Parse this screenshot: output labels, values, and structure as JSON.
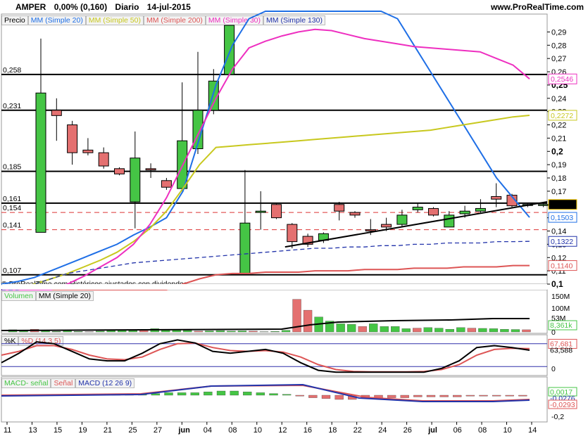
{
  "header": {
    "symbol": "AMPER",
    "change": "0,00% (0,160)",
    "period": "Diario",
    "date": "14-jul-2015",
    "site": "www.ProRealTime.com"
  },
  "price_legend": {
    "price": "Precio",
    "mm20": "MM (Simple 20)",
    "mm50": "MM (Simple 50)",
    "mm200": "MM (Simple 200)",
    "mm30": "MM (Simple 30)",
    "mm130": "MM (Simple 130)"
  },
  "copyright": "© ProRealTime.com  Históricos ajustados con dividendos",
  "volume_legend": {
    "vol": "Volumen",
    "mm": "MM (Simple 20)"
  },
  "stoch_legend": {
    "k": "%K",
    "d": "%D (14 3 5)"
  },
  "macd_legend": {
    "hist": "MACD- señal",
    "sig": "Señal",
    "macd": "MACD (12 26 9)"
  },
  "colors": {
    "up": "#45c545",
    "down": "#e47070",
    "mm20": "#1f6fe6",
    "mm50": "#c8c81e",
    "mm200": "#dd5555",
    "mm30": "#ee2fc0",
    "mm130": "#2233aa"
  },
  "chart_data": {
    "type": "candlestick",
    "x_ticks": [
      "11",
      "13",
      "15",
      "19",
      "21",
      "25",
      "27",
      "jun",
      "04",
      "08",
      "10",
      "12",
      "16",
      "18",
      "22",
      "24",
      "26",
      "jul",
      "06",
      "08",
      "10",
      "14"
    ],
    "price_axis": [
      "0,29",
      "0,28",
      "0,27",
      "0,26",
      "0,25",
      "0,24",
      "0,23",
      "0,22",
      "0,21",
      "0,2",
      "0,19",
      "0,18",
      "0,17",
      "0,16",
      "0,15",
      "0,14",
      "0,13",
      "0,12",
      "0,11",
      "0,1"
    ],
    "ylim": [
      0.1,
      0.295
    ],
    "horizontal_levels": [
      {
        "label": "0,258",
        "value": 0.258,
        "style": "solid"
      },
      {
        "label": "0,231",
        "value": 0.231,
        "style": "solid"
      },
      {
        "label": "0,185",
        "value": 0.185,
        "style": "solid"
      },
      {
        "label": "0,161",
        "value": 0.161,
        "style": "solid"
      },
      {
        "label": "0,154",
        "value": 0.154,
        "style": "dashed"
      },
      {
        "label": "0,141",
        "value": 0.141,
        "style": "dashed"
      },
      {
        "label": "0,107",
        "value": 0.107,
        "style": "solid"
      }
    ],
    "candles": [
      {
        "o": 0.139,
        "h": 0.285,
        "l": 0.139,
        "c": 0.244
      },
      {
        "o": 0.231,
        "h": 0.24,
        "l": 0.208,
        "c": 0.227
      },
      {
        "o": 0.22,
        "h": 0.223,
        "l": 0.19,
        "c": 0.199
      },
      {
        "o": 0.201,
        "h": 0.21,
        "l": 0.197,
        "c": 0.199
      },
      {
        "o": 0.199,
        "h": 0.203,
        "l": 0.187,
        "c": 0.189
      },
      {
        "o": 0.187,
        "h": 0.188,
        "l": 0.182,
        "c": 0.183
      },
      {
        "o": 0.162,
        "h": 0.215,
        "l": 0.142,
        "c": 0.195
      },
      {
        "o": 0.187,
        "h": 0.191,
        "l": 0.18,
        "c": 0.186
      },
      {
        "o": 0.178,
        "h": 0.18,
        "l": 0.171,
        "c": 0.173
      },
      {
        "o": 0.172,
        "h": 0.252,
        "l": 0.17,
        "c": 0.208
      },
      {
        "o": 0.202,
        "h": 0.275,
        "l": 0.198,
        "c": 0.231
      },
      {
        "o": 0.231,
        "h": 0.262,
        "l": 0.228,
        "c": 0.253
      },
      {
        "o": 0.258,
        "h": 0.295,
        "l": 0.257,
        "c": 0.295
      },
      {
        "o": 0.108,
        "h": 0.186,
        "l": 0.108,
        "c": 0.146
      },
      {
        "o": 0.154,
        "h": 0.17,
        "l": 0.141,
        "c": 0.155
      },
      {
        "o": 0.16,
        "h": 0.161,
        "l": 0.149,
        "c": 0.15
      },
      {
        "o": 0.145,
        "h": 0.146,
        "l": 0.127,
        "c": 0.132
      },
      {
        "o": 0.136,
        "h": 0.138,
        "l": 0.128,
        "c": 0.13
      },
      {
        "o": 0.133,
        "h": 0.139,
        "l": 0.131,
        "c": 0.138
      },
      {
        "o": 0.16,
        "h": 0.162,
        "l": 0.148,
        "c": 0.155
      },
      {
        "o": 0.154,
        "h": 0.155,
        "l": 0.15,
        "c": 0.152
      },
      {
        "o": 0.141,
        "h": 0.149,
        "l": 0.137,
        "c": 0.14
      },
      {
        "o": 0.145,
        "h": 0.15,
        "l": 0.14,
        "c": 0.143
      },
      {
        "o": 0.145,
        "h": 0.156,
        "l": 0.143,
        "c": 0.152
      },
      {
        "o": 0.156,
        "h": 0.161,
        "l": 0.154,
        "c": 0.158
      },
      {
        "o": 0.157,
        "h": 0.158,
        "l": 0.151,
        "c": 0.152
      },
      {
        "o": 0.143,
        "h": 0.155,
        "l": 0.143,
        "c": 0.152
      },
      {
        "o": 0.153,
        "h": 0.159,
        "l": 0.15,
        "c": 0.155
      },
      {
        "o": 0.155,
        "h": 0.164,
        "l": 0.153,
        "c": 0.157
      },
      {
        "o": 0.166,
        "h": 0.176,
        "l": 0.158,
        "c": 0.164
      },
      {
        "o": 0.167,
        "h": 0.168,
        "l": 0.158,
        "c": 0.159
      },
      {
        "o": 0.16,
        "h": 0.161,
        "l": 0.158,
        "c": 0.16
      },
      {
        "o": 0.16,
        "h": 0.161,
        "l": 0.158,
        "c": 0.16
      }
    ],
    "series": [
      {
        "name": "MM (Simple 20)",
        "values": [
          0.1,
          0.102,
          0.105,
          0.11,
          0.115,
          0.12,
          0.125,
          0.13,
          0.137,
          0.143,
          0.15,
          0.17,
          0.21,
          0.25,
          0.28,
          0.3,
          0.32,
          0.32,
          0.32,
          0.32,
          0.32,
          0.32,
          0.32,
          0.32,
          0.3,
          0.28,
          0.26,
          0.24,
          0.22,
          0.2,
          0.18,
          0.165,
          0.1503
        ]
      },
      {
        "name": "MM (Simple 50)",
        "values": [
          0.09,
          0.095,
          0.1,
          0.104,
          0.108,
          0.113,
          0.118,
          0.124,
          0.132,
          0.142,
          0.155,
          0.172,
          0.19,
          0.203,
          0.204,
          0.205,
          0.206,
          0.207,
          0.208,
          0.209,
          0.21,
          0.211,
          0.212,
          0.213,
          0.214,
          0.215,
          0.216,
          0.218,
          0.22,
          0.222,
          0.224,
          0.226,
          0.2272
        ]
      },
      {
        "name": "MM (Simple 200)",
        "values": [
          0.07,
          0.072,
          0.074,
          0.076,
          0.078,
          0.08,
          0.082,
          0.084,
          0.086,
          0.09,
          0.095,
          0.1,
          0.104,
          0.107,
          0.108,
          0.108,
          0.109,
          0.109,
          0.109,
          0.11,
          0.11,
          0.11,
          0.111,
          0.111,
          0.111,
          0.112,
          0.112,
          0.112,
          0.113,
          0.113,
          0.113,
          0.114,
          0.114
        ]
      },
      {
        "name": "MM (Simple 30)",
        "values": [
          0.08,
          0.085,
          0.09,
          0.095,
          0.1,
          0.106,
          0.113,
          0.12,
          0.13,
          0.145,
          0.165,
          0.19,
          0.215,
          0.24,
          0.262,
          0.278,
          0.283,
          0.287,
          0.29,
          0.292,
          0.291,
          0.288,
          0.285,
          0.283,
          0.281,
          0.279,
          0.278,
          0.277,
          0.276,
          0.275,
          0.27,
          0.265,
          0.2546
        ]
      },
      {
        "name": "MM (Simple 130)",
        "values": [
          0.09,
          0.095,
          0.1,
          0.104,
          0.108,
          0.11,
          0.112,
          0.114,
          0.116,
          0.117,
          0.118,
          0.119,
          0.12,
          0.121,
          0.122,
          0.123,
          0.124,
          0.125,
          0.126,
          0.127,
          0.127,
          0.128,
          0.128,
          0.129,
          0.129,
          0.13,
          0.13,
          0.131,
          0.131,
          0.131,
          0.132,
          0.132,
          0.1322
        ]
      }
    ],
    "right_labels": [
      "0,2546",
      "0,2272",
      "0,160",
      "0,1503",
      "0,1322",
      "0,1140"
    ],
    "volume": {
      "axis": [
        "150M",
        "100M",
        "53M",
        "8,361k",
        "0"
      ],
      "bars": [
        8,
        3,
        10,
        4,
        2,
        5,
        2,
        1,
        3,
        5,
        6,
        5,
        8,
        12,
        10,
        9,
        6,
        3,
        4,
        5,
        3,
        4,
        3,
        1,
        2,
        6,
        120,
        80,
        55,
        40,
        30,
        28,
        20,
        30,
        20,
        20,
        12,
        14,
        16,
        14,
        10,
        16,
        14,
        13,
        12,
        10,
        9,
        8
      ]
    },
    "stochastic": {
      "k": 63.588,
      "d": 67.681,
      "axis": [
        "67,681",
        "63,588",
        "0"
      ]
    },
    "macd": {
      "values": [
        0.0017,
        -0.0276,
        -0.0293
      ],
      "axis": [
        "0,0017",
        "-0,0276",
        "-0,0293",
        "-0,2"
      ]
    }
  }
}
